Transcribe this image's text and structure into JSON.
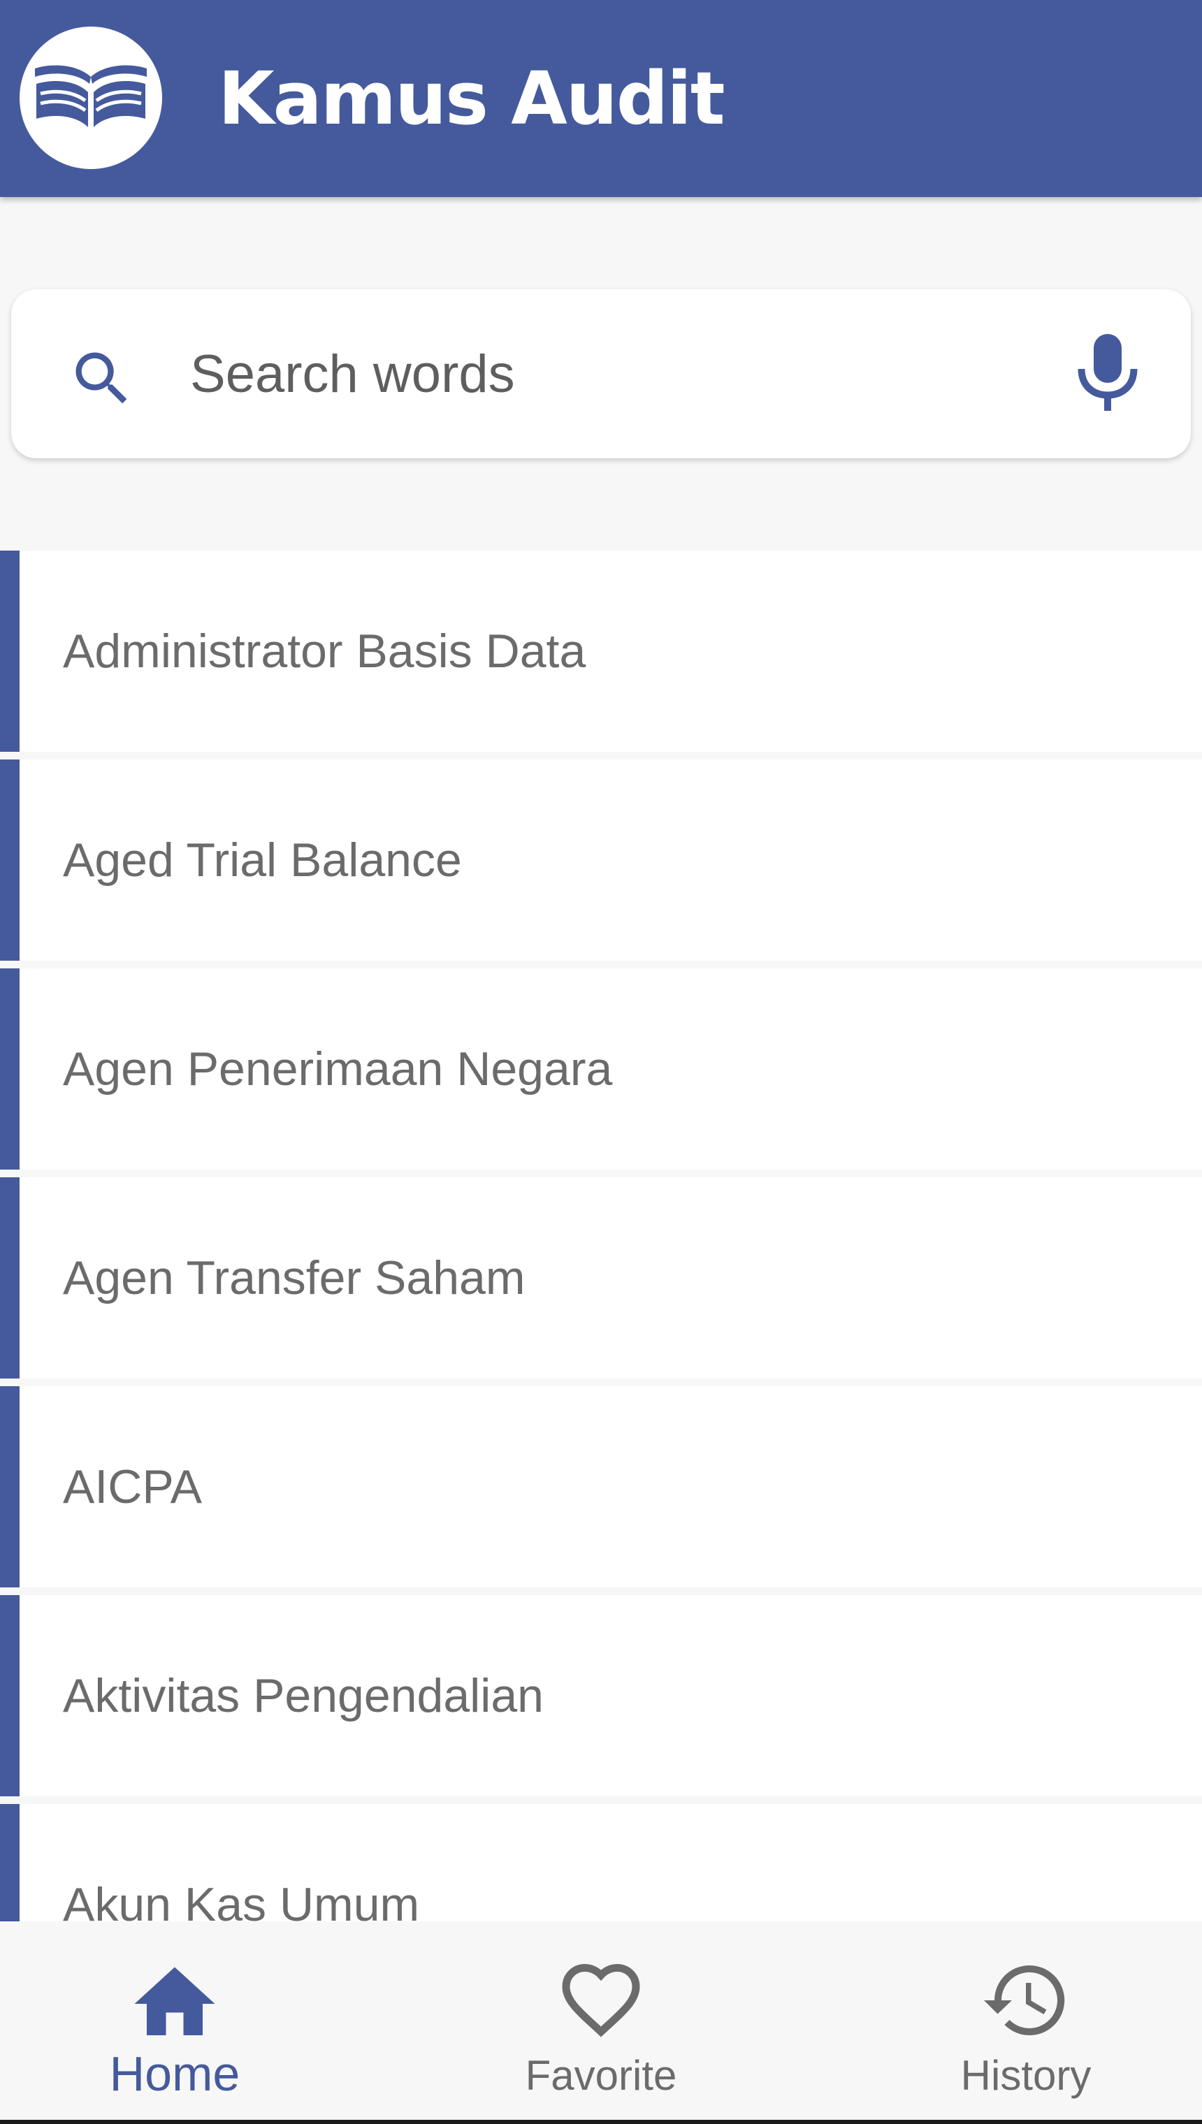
{
  "app": {
    "title": "Kamus Audit",
    "logo_icon": "open-book-icon",
    "accent_color": "#455a9c"
  },
  "search": {
    "placeholder": "Search words",
    "value": "",
    "left_icon": "search-icon",
    "right_icon": "microphone-icon"
  },
  "words": [
    {
      "label": "Administrator Basis Data"
    },
    {
      "label": "Aged Trial Balance"
    },
    {
      "label": "Agen Penerimaan Negara"
    },
    {
      "label": "Agen Transfer Saham"
    },
    {
      "label": "AICPA"
    },
    {
      "label": "Aktivitas Pengendalian"
    },
    {
      "label": "Akun Kas Umum"
    }
  ],
  "nav": {
    "items": [
      {
        "label": "Home",
        "icon": "home-icon",
        "active": true
      },
      {
        "label": "Favorite",
        "icon": "heart-icon",
        "active": false
      },
      {
        "label": "History",
        "icon": "history-icon",
        "active": false
      }
    ]
  }
}
